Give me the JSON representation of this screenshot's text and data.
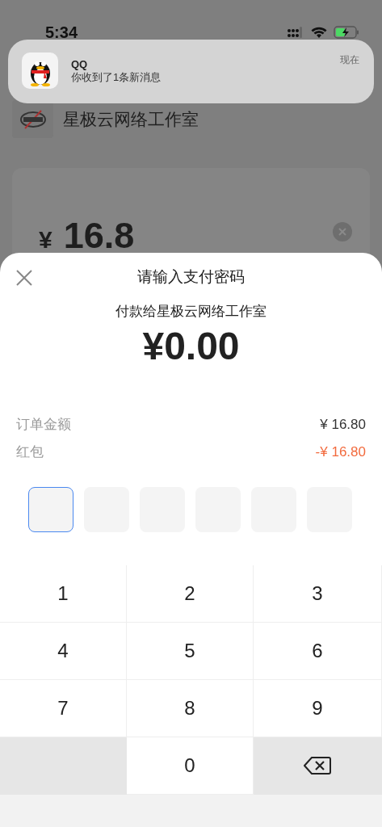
{
  "status_bar": {
    "time": "5:34"
  },
  "notification": {
    "app": "QQ",
    "message": "你收到了1条新消息",
    "time": "现在"
  },
  "merchant": {
    "name": "星极云网络工作室"
  },
  "amount_card": {
    "currency": "¥",
    "amount": "16.8"
  },
  "sheet": {
    "title": "请输入支付密码",
    "payee": "付款给星极云网络工作室",
    "total": "¥0.00",
    "lines": [
      {
        "label": "订单金额",
        "value": "¥ 16.80",
        "kind": "normal"
      },
      {
        "label": "红包",
        "value": "-¥ 16.80",
        "kind": "discount"
      }
    ],
    "pin_boxes": [
      {
        "selected": true
      },
      {
        "selected": false
      },
      {
        "selected": false
      },
      {
        "selected": false
      },
      {
        "selected": false
      },
      {
        "selected": false
      }
    ]
  },
  "keypad": [
    {
      "kind": "digit",
      "label": "1"
    },
    {
      "kind": "digit",
      "label": "2"
    },
    {
      "kind": "digit",
      "label": "3"
    },
    {
      "kind": "digit",
      "label": "4"
    },
    {
      "kind": "digit",
      "label": "5"
    },
    {
      "kind": "digit",
      "label": "6"
    },
    {
      "kind": "digit",
      "label": "7"
    },
    {
      "kind": "digit",
      "label": "8"
    },
    {
      "kind": "digit",
      "label": "9"
    },
    {
      "kind": "blank"
    },
    {
      "kind": "digit",
      "label": "0"
    },
    {
      "kind": "delete"
    }
  ]
}
